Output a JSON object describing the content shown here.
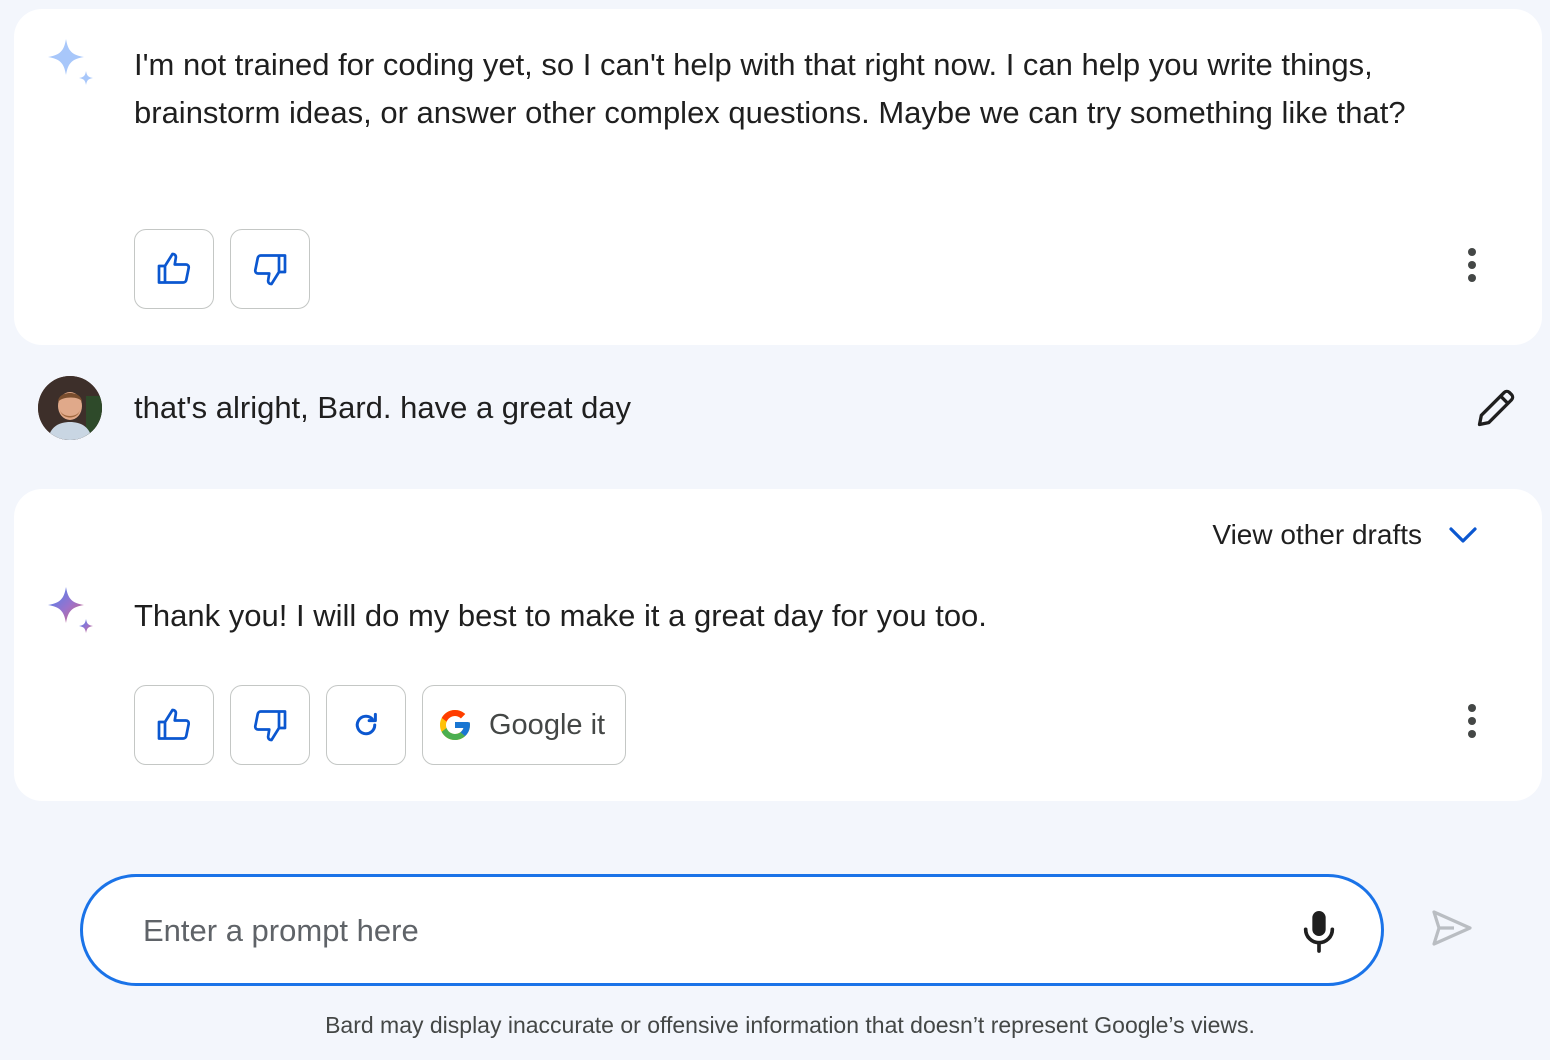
{
  "conversation": {
    "response_1": {
      "text": "I'm not trained for coding yet, so I can't help with that right now. I can help you write things, brainstorm ideas, or answer other complex questions. Maybe we can try something like that?"
    },
    "user_message": {
      "text": "that's alright, Bard. have a great day"
    },
    "response_2": {
      "drafts_label": "View other drafts",
      "text": "Thank you! I will do my best to make it a great day for you too.",
      "google_it_label": "Google it"
    }
  },
  "composer": {
    "placeholder": "Enter a prompt here"
  },
  "footer": {
    "disclaimer": "Bard may display inaccurate or offensive information that doesn’t represent Google’s views."
  },
  "colors": {
    "accent": "#1a73e8",
    "background": "#f3f6fc",
    "card": "#ffffff",
    "icon_blue": "#0b57d0"
  },
  "icons": [
    "sparkle-icon",
    "thumbs-up-icon",
    "thumbs-down-icon",
    "more-vert-icon",
    "edit-icon",
    "chevron-down-icon",
    "regenerate-icon",
    "google-g-icon",
    "mic-icon",
    "send-icon",
    "avatar"
  ]
}
